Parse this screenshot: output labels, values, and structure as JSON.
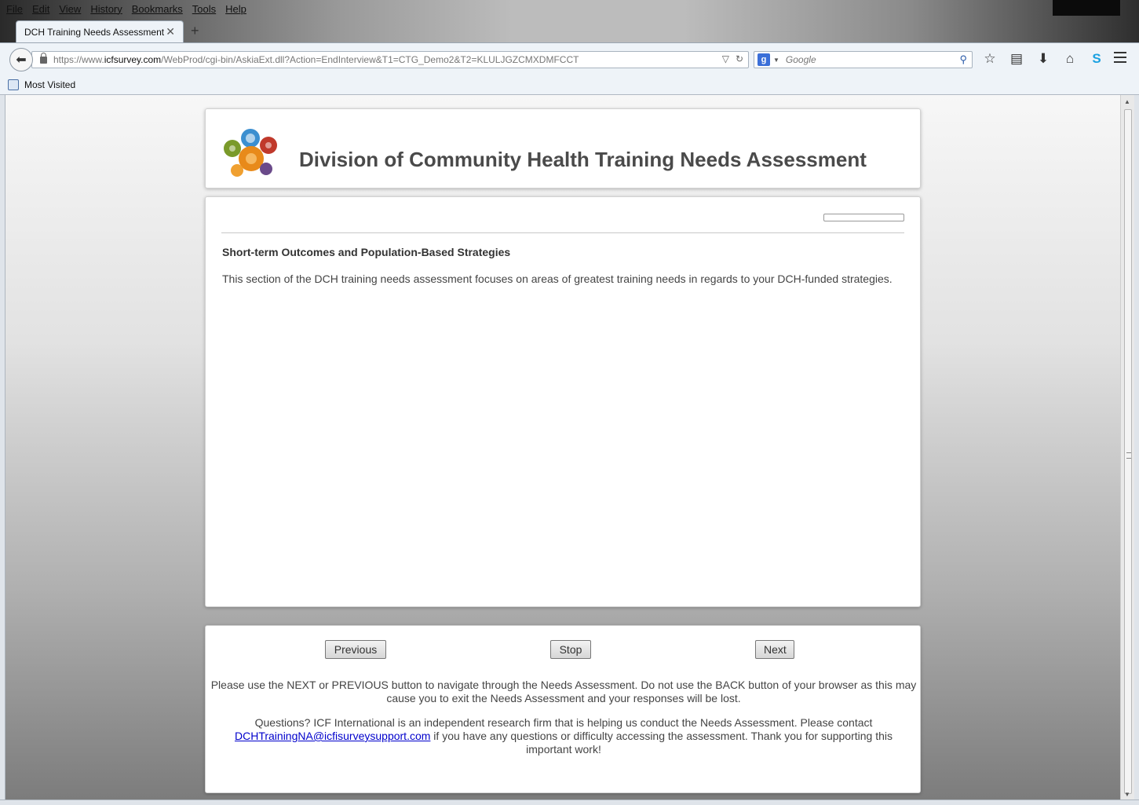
{
  "menubar": [
    "File",
    "Edit",
    "View",
    "History",
    "Bookmarks",
    "Tools",
    "Help"
  ],
  "tab": {
    "title": "DCH Training Needs Assessment",
    "close_glyph": "✕",
    "new_glyph": "+"
  },
  "url": {
    "prefix": "https://www.",
    "domain": "icfsurvey.com",
    "suffix": "/WebProd/cgi-bin/AskiaExt.dll?Action=EndInterview&T1=CTG_Demo2&T2=KLULJGZCMXDMFCCT"
  },
  "search": {
    "placeholder": "Google"
  },
  "toolbar_icons": [
    "star-icon",
    "reading-list-icon",
    "download-icon",
    "home-icon",
    "skype-icon",
    "hamburger-menu-icon"
  ],
  "bookmarks": {
    "most_visited": "Most Visited"
  },
  "page": {
    "title": "Division of Community Health Training Needs Assessment",
    "section_title": "Short-term Outcomes and Population-Based Strategies",
    "section_body": "This section of the DCH training needs assessment focuses on areas of greatest training needs in regards to your DCH-funded strategies.",
    "progress_percent": 0
  },
  "footer": {
    "previous_label": "Previous",
    "stop_label": "Stop",
    "next_label": "Next",
    "note1": "Please use the NEXT or PREVIOUS button to navigate through the Needs Assessment. Do not use the BACK button of your browser as this may cause you to exit the Needs Assessment and your responses will be lost.",
    "note2_before": "Questions? ICF International is an independent research firm that is helping us conduct the Needs Assessment. Please contact ",
    "email": "DCHTrainingNA@icfisurveysupport.com",
    "note2_after": " if you have any questions or difficulty accessing the assessment. Thank you for supporting this important work!"
  },
  "colors": {
    "title_text": "#4a4a4a",
    "link": "#0000cc",
    "logo_green": "#7a9a2a",
    "logo_blue": "#3b8fd0",
    "logo_red": "#c0392b",
    "logo_orange": "#e88a1a",
    "logo_purple": "#6a4a8a"
  }
}
